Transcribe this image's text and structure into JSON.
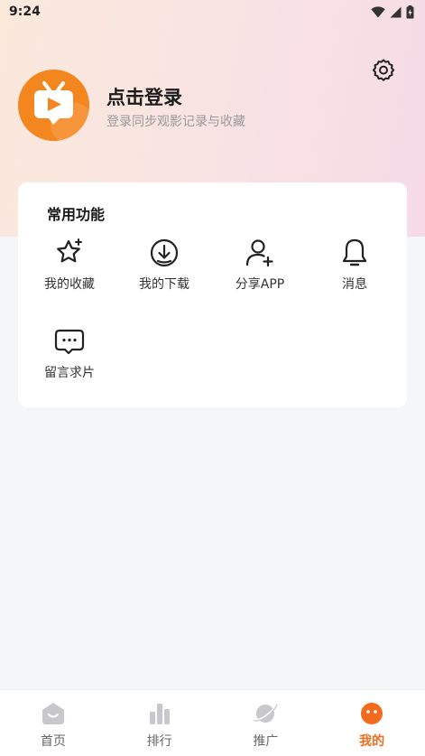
{
  "status_bar": {
    "time": "9:24"
  },
  "profile": {
    "title": "点击登录",
    "subtitle": "登录同步观影记录与收藏"
  },
  "functions": {
    "section_title": "常用功能",
    "items": [
      {
        "label": "我的收藏",
        "icon": "star-icon"
      },
      {
        "label": "我的下载",
        "icon": "download-icon"
      },
      {
        "label": "分享APP",
        "icon": "add-user-icon"
      },
      {
        "label": "消息",
        "icon": "bell-icon"
      },
      {
        "label": "留言求片",
        "icon": "chat-icon"
      }
    ]
  },
  "tabbar": {
    "items": [
      {
        "label": "首页",
        "icon": "home-icon",
        "active": false
      },
      {
        "label": "排行",
        "icon": "bar-chart-icon",
        "active": false
      },
      {
        "label": "推广",
        "icon": "planet-icon",
        "active": false
      },
      {
        "label": "我的",
        "icon": "smiley-icon",
        "active": true
      }
    ]
  },
  "colors": {
    "accent": "#f26b1d",
    "brand_orange": "#f4861f",
    "inactive_tab": "#c8c8cc"
  }
}
